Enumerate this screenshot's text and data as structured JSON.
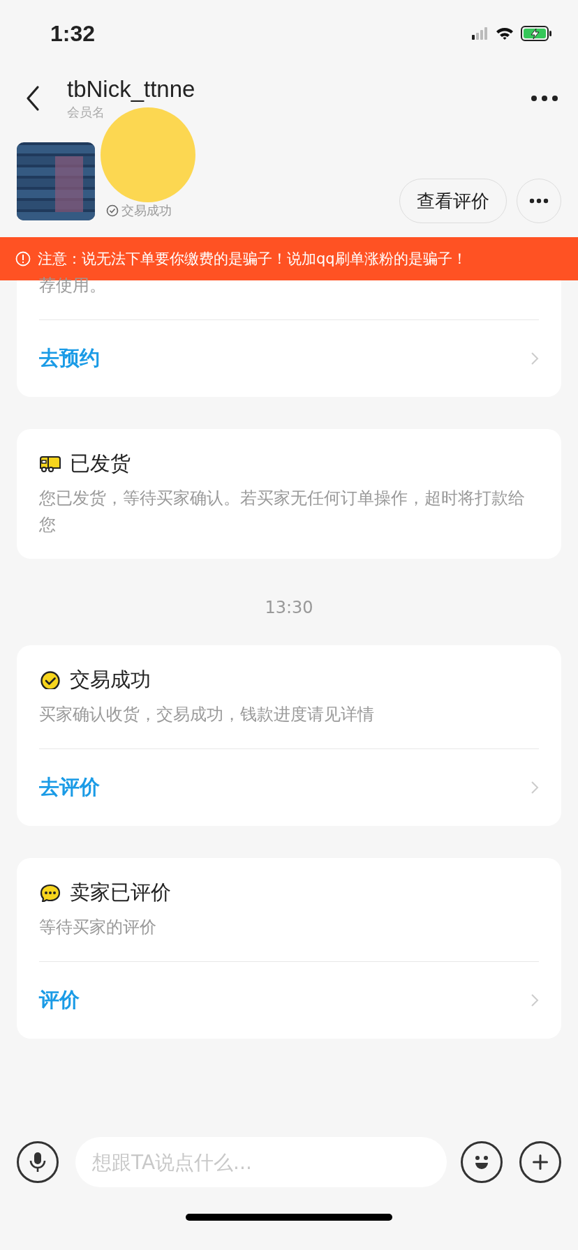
{
  "status_bar": {
    "time": "1:32"
  },
  "header": {
    "title": "tbNick_ttnne",
    "subtitle": "会员名"
  },
  "order": {
    "kind": "picture",
    "status": "交易成功",
    "buttons": [
      "查看评价"
    ]
  },
  "notice": {
    "text": "注意：说无法下单要你缴费的是骗子！说加qq刷单涨粉的是骗子！"
  },
  "messages": [
    {
      "kind": "booking",
      "body": "荐使用。",
      "action": "去预约"
    },
    {
      "kind": "shipped",
      "title": "已发货",
      "body": "您已发货，等待买家确认。若买家无任何订单操作，超时将打款给您"
    },
    {
      "kind": "time",
      "text": "13:30"
    },
    {
      "kind": "success",
      "title": "交易成功",
      "body": "买家确认收货，交易成功，钱款进度请见详情",
      "action": "去评价"
    },
    {
      "kind": "review",
      "title": "卖家已评价",
      "body": "等待买家的评价",
      "action": "评价"
    }
  ],
  "input": {
    "placeholder": "想跟TA说点什么..."
  }
}
